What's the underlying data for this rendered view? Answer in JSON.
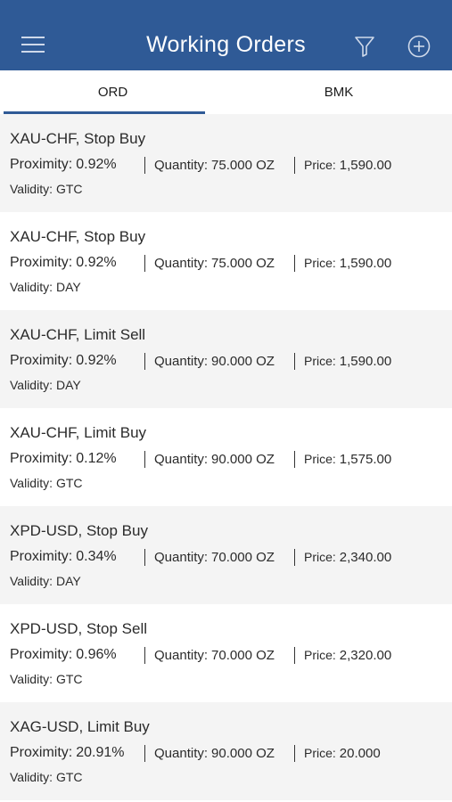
{
  "header": {
    "title": "Working Orders",
    "icons": [
      "menu-icon",
      "filter-icon",
      "add-circle-icon"
    ],
    "background": "#2f5a96"
  },
  "tabs": [
    {
      "label": "ORD",
      "active": true
    },
    {
      "label": "BMK",
      "active": false
    }
  ],
  "labels": {
    "proximity": "Proximity:",
    "quantity": "Quantity:",
    "price": "Price:",
    "validity": "Validity:"
  },
  "orders": [
    {
      "title": "XAU-CHF, Stop Buy",
      "proximity": "0.92%",
      "quantity": "75.000 OZ",
      "price": "1,590.00",
      "validity": "GTC"
    },
    {
      "title": "XAU-CHF, Stop Buy",
      "proximity": "0.92%",
      "quantity": "75.000 OZ",
      "price": "1,590.00",
      "validity": "DAY"
    },
    {
      "title": "XAU-CHF, Limit Sell",
      "proximity": "0.92%",
      "quantity": "90.000 OZ",
      "price": "1,590.00",
      "validity": "DAY"
    },
    {
      "title": "XAU-CHF, Limit Buy",
      "proximity": "0.12%",
      "quantity": "90.000 OZ",
      "price": "1,575.00",
      "validity": "GTC"
    },
    {
      "title": "XPD-USD, Stop Buy",
      "proximity": "0.34%",
      "quantity": "70.000 OZ",
      "price": "2,340.00",
      "validity": "DAY"
    },
    {
      "title": "XPD-USD, Stop Sell",
      "proximity": "0.96%",
      "quantity": "70.000 OZ",
      "price": "2,320.00",
      "validity": "GTC"
    },
    {
      "title": "XAG-USD, Limit Buy",
      "proximity": "20.91%",
      "quantity": "90.000 OZ",
      "price": "20.000",
      "validity": "GTC"
    }
  ]
}
